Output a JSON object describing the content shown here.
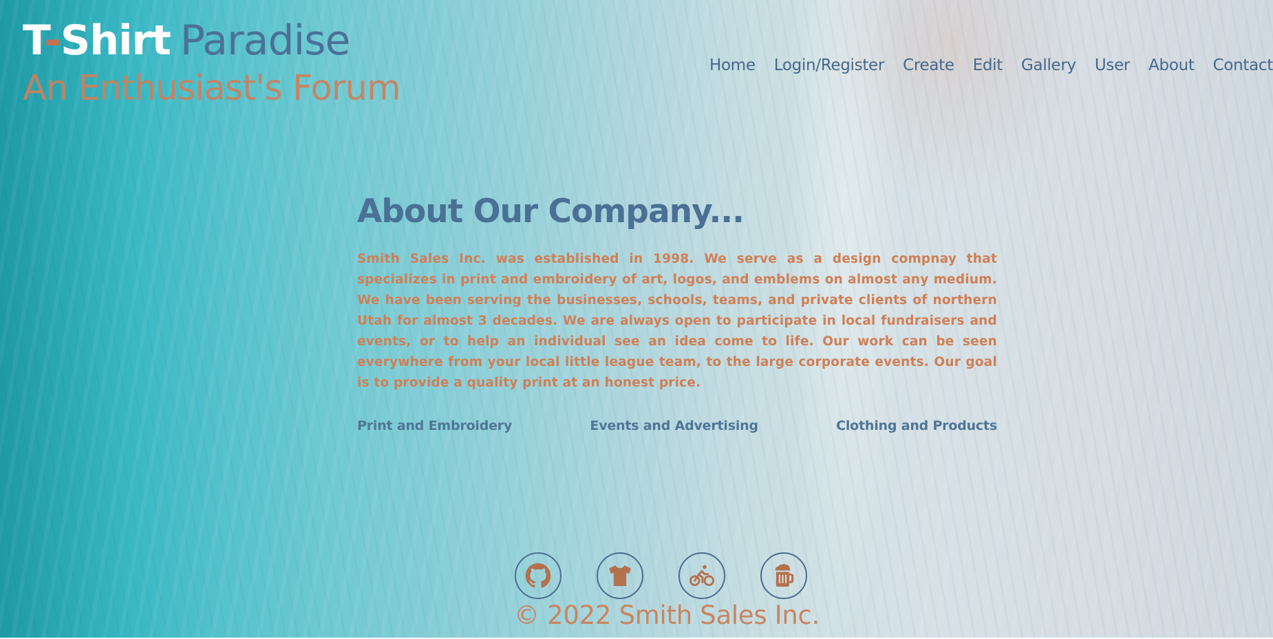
{
  "brand": {
    "title_part1": "T",
    "title_dash": "-",
    "title_part2": "Shirt",
    "title_part3": "Paradise",
    "subtitle": "An Enthusiast's Forum"
  },
  "nav": {
    "items": [
      "Home",
      "Login/Register",
      "Create",
      "Edit",
      "Gallery",
      "User",
      "About",
      "Contact"
    ]
  },
  "about": {
    "heading": "About Our Company...",
    "body": "Smith Sales Inc. was established in 1998. We serve as a design compnay that specializes in print and embroidery of art, logos, and emblems on almost any medium. We have been serving the businesses, schools, teams, and private clients of northern Utah for almost 3 decades. We are always open to participate in local fundraisers and events, or to help an individual see an idea come to life. Our work can be seen everywhere from your local little league team, to the large corporate events. Our goal is to provide a quality print at an honest price.",
    "services": [
      "Print and Embroidery",
      "Events and Advertising",
      "Clothing and Products"
    ]
  },
  "footer": {
    "icons": [
      "github-icon",
      "tshirt-icon",
      "bicycle-icon",
      "beer-mug-icon"
    ],
    "copyright": "© 2022 Smith Sales Inc."
  },
  "colors": {
    "brand_accent": "#c2724d",
    "heading_blue": "#4a7095",
    "body_orange": "#cf7f55",
    "nav_text": "#46678a",
    "icon_fill": "#b4714d"
  }
}
